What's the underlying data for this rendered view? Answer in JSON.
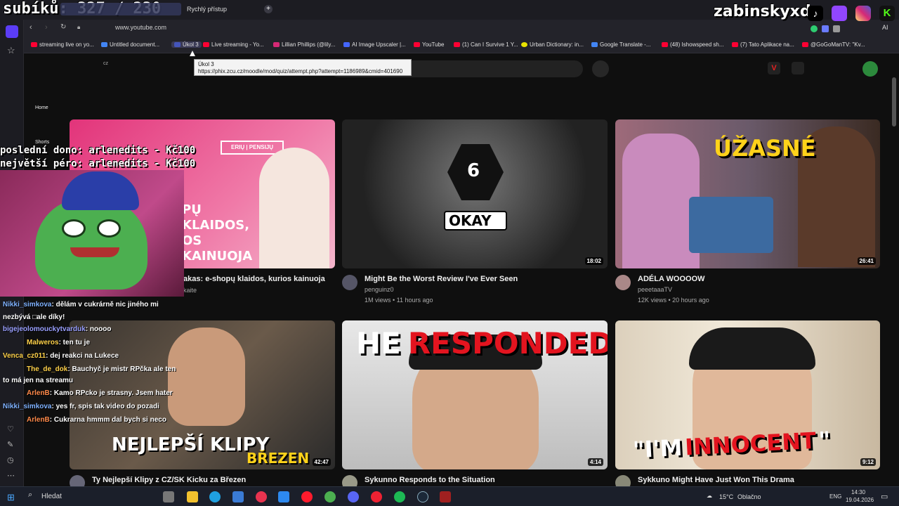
{
  "overlay": {
    "sub_counter": "subíků: 327 / 230",
    "channel_name": "zabinskyxd",
    "last_donation": "poslední dono: arlenedits - Kč100",
    "biggest_donation": "největší péro: arlenedits - Kč100"
  },
  "browser": {
    "tab_quick_access": "Rychlý přístup",
    "url": "www.youtube.com",
    "ai_label": "AI",
    "bookmarks": [
      "streaming live on yo...",
      "Untitled document...",
      "Úkol 3",
      "Live streaming - Yo...",
      "Lillian Phillips (@lily...",
      "AI Image Upscaler |...",
      "YouTube",
      "(1) Can I Survive 1 Y...",
      "Urban Dictionary: in...",
      "Google Translate -...",
      "(48) Ishowspeed sh...",
      "(7) Tato Aplikace na...",
      "@GoGoManTV: \"Kv..."
    ],
    "tooltip_title": "Úkol 3",
    "tooltip_url": "https://phix.zcu.cz/moodle/mod/quiz/attempt.php?attempt=1186989&cmid=401690"
  },
  "youtube": {
    "logo_suffix": "cz",
    "nav": {
      "home": "Home",
      "shorts": "Shorts"
    },
    "videos": [
      {
        "title": "akas: e-shopų klaidos, kurios kainuoja",
        "channel": "kaite",
        "meta": "",
        "duration": "",
        "thumb_text": "PŲ KLAIDOS, OS KAINUOJA",
        "thumb_badge": "ERIŲ | PENSIJŲ"
      },
      {
        "title": "Might Be the Worst Review I've Ever Seen",
        "channel": "penguinz0",
        "meta": "1M views • 11 hours ago",
        "duration": "18:02",
        "thumb_text": "OKAY",
        "thumb_number": "6"
      },
      {
        "title": "ADÉLA WOOOOW",
        "channel": "peeetaaaTV",
        "meta": "12K views • 20 hours ago",
        "duration": "26:41",
        "thumb_text": "ÚŽASNÉ"
      },
      {
        "title": "Ty Nejlepší Klipy z CZ/SK Kicku za Březen",
        "channel": "",
        "meta": "",
        "duration": "42:47",
        "thumb_text": "NEJLEPŠÍ KLIPY",
        "thumb_sub": "BŘEZEN"
      },
      {
        "title": "Sykunno Responds to the Situation",
        "channel": "",
        "meta": "",
        "duration": "4:14",
        "thumb_text_white": "HE",
        "thumb_text_red": "RESPONDED"
      },
      {
        "title": "Sykkuno Might Have Just Won This Drama",
        "channel": "",
        "meta": "",
        "duration": "9:12",
        "thumb_text_white": "\"I'M",
        "thumb_text_red": "INNOCENT",
        "thumb_text_end": "\""
      }
    ]
  },
  "chat": [
    {
      "user": "Nikki_simkova",
      "user_color": "#7fb2ff",
      "message": ": dělám v cukrárně nic jiného mi"
    },
    {
      "user": "",
      "user_color": "#ffffff",
      "message": "nezbývá □ale díky!"
    },
    {
      "user": "bigejeolomouckytvarduk",
      "user_color": "#9aa0ff",
      "message": ": noooo"
    },
    {
      "user": "Malweros",
      "user_color": "#ffd24a",
      "message": ": ten tu je"
    },
    {
      "user": "Venca_cz011",
      "user_color": "#ffd24a",
      "message": ": dej reakci na Lukece"
    },
    {
      "user": "The_de_dok",
      "user_color": "#ffd24a",
      "message": ": Bauchyč je mistr RPčka ale ten"
    },
    {
      "user": "",
      "user_color": "#ffffff",
      "message": "to má jen na streamu"
    },
    {
      "user": "ArlenB",
      "user_color": "#ff8a4a",
      "message": ": Kamo RPcko je strasny. Jsem hater"
    },
    {
      "user": "Nikki_simkova",
      "user_color": "#7fb2ff",
      "message": ": yes fr, spis tak video do pozadi"
    },
    {
      "user": "ArlenB",
      "user_color": "#ff8a4a",
      "message": ": Cukrarna hmmm dal bych si neco"
    }
  ],
  "taskbar": {
    "search_placeholder": "Hledat",
    "temperature": "15°C",
    "weather": "Oblačno",
    "language": "ENG",
    "time": "14:30",
    "date": "19.04.2026"
  }
}
